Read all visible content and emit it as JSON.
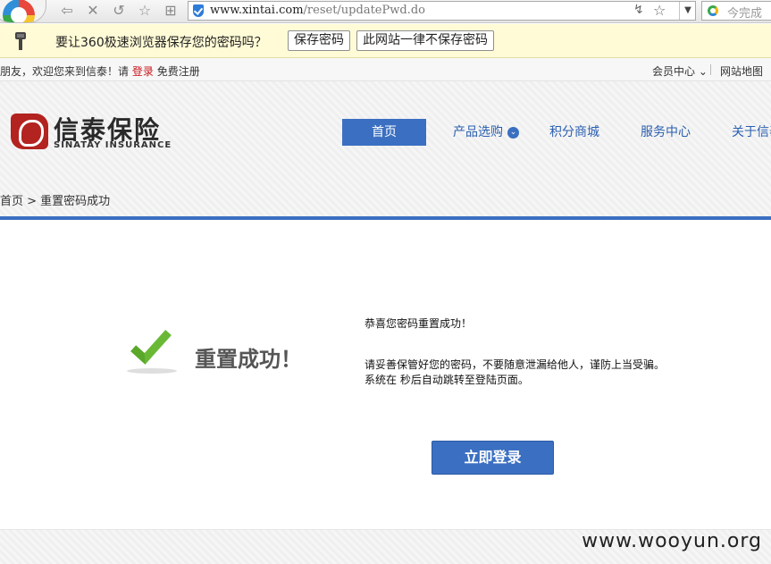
{
  "browser": {
    "url_host": "www.xintai.com",
    "url_path": "/reset/updatePwd.do",
    "search_placeholder": "今完成",
    "icons": [
      "back-icon",
      "close-icon",
      "undo-icon",
      "favorite-icon",
      "grid-icon",
      "shield-icon",
      "bolt-icon",
      "star-icon",
      "dropdown-icon",
      "search-icon"
    ]
  },
  "password_prompt": {
    "message": "要让360极速浏览器保存您的密码吗？",
    "save_label": "保存密码",
    "never_label": "此网站一律不保存密码"
  },
  "topbar": {
    "welcome_prefix": "朋友，欢迎您来到信泰！请",
    "login_link": "登录",
    "register_link": "免费注册",
    "member_center": "会员中心",
    "sitemap": "网站地图"
  },
  "brand": {
    "name_cn": "信泰保险",
    "name_en": "SINATAY INSURANCE"
  },
  "nav": {
    "items": [
      "首页",
      "产品选购",
      "积分商城",
      "服务中心",
      "关于信泰"
    ],
    "active_index": 0
  },
  "breadcrumb": "首页 > 重置密码成功",
  "content": {
    "title": "重置成功！",
    "line1": "恭喜您密码重置成功！",
    "line2": "请妥善保管好您的密码，不要随意泄漏给他人，谨防上当受骗。",
    "line3": "系统在 秒后自动跳转至登陆页面。",
    "login_button": "立即登录"
  },
  "watermark": "www.wooyun.org",
  "colors": {
    "accent_blue": "#3b6fc1",
    "login_red": "#c8161d",
    "prompt_bg": "#fffbd6",
    "check_green": "#6ab936"
  }
}
